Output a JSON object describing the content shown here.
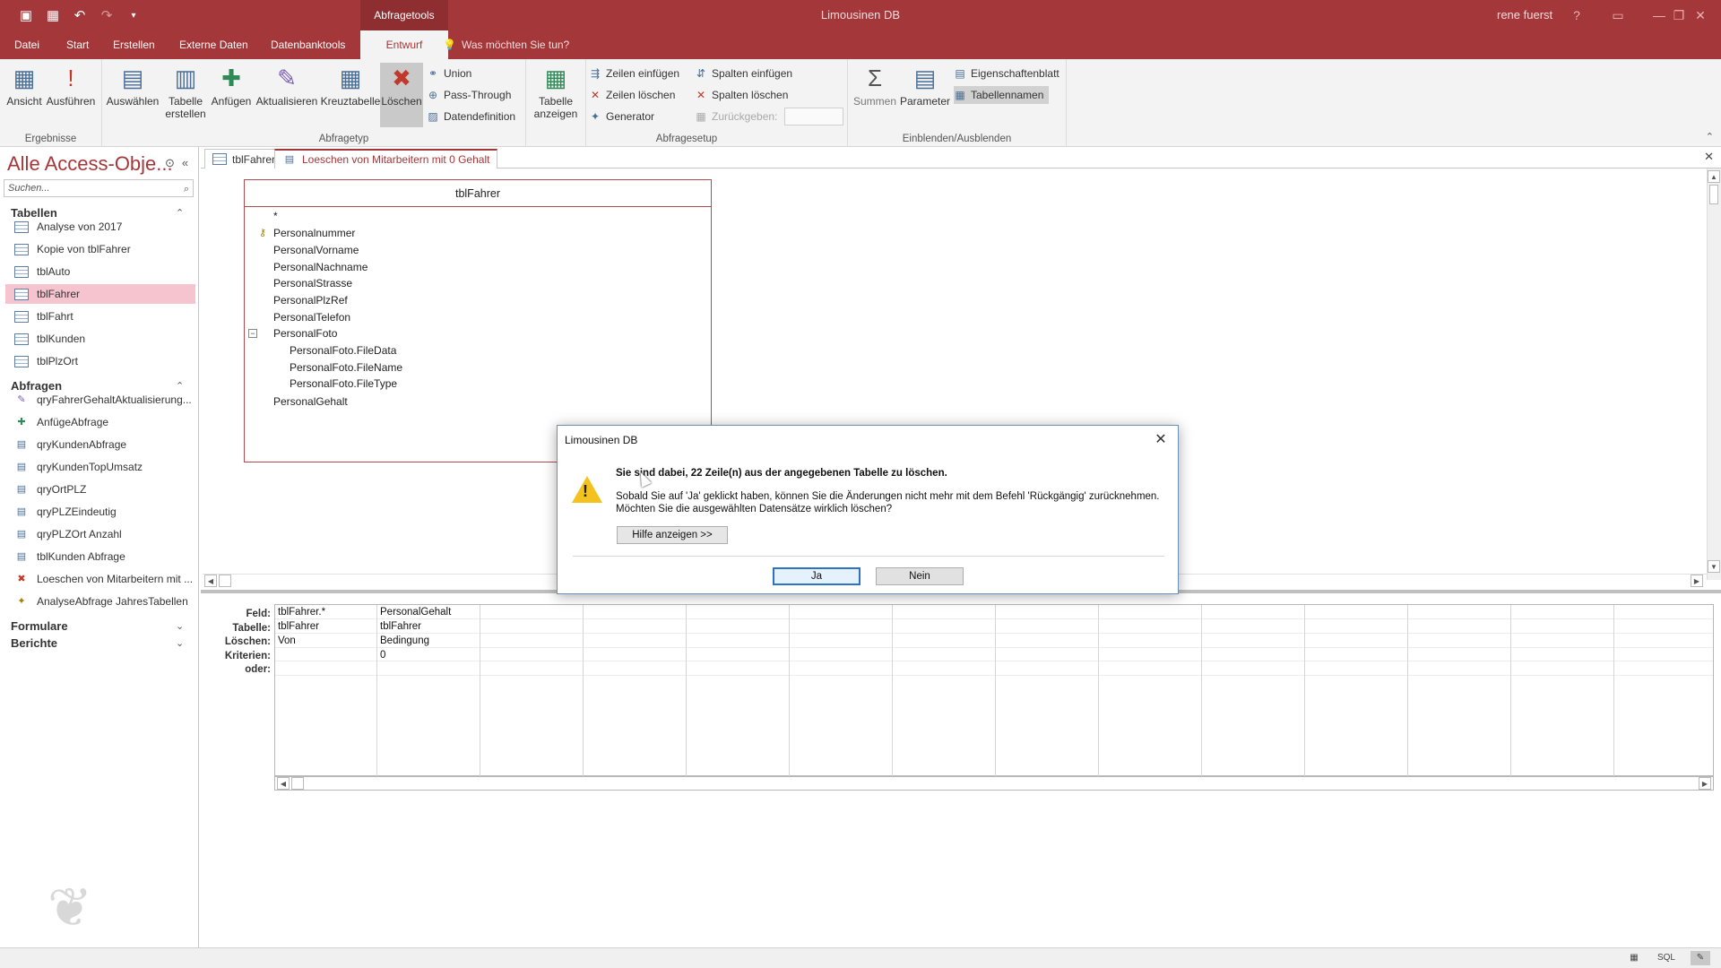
{
  "window": {
    "app_title": "Limousinen DB",
    "context_tab_label": "Abfragetools",
    "user_name": "rene fuerst"
  },
  "ribbon_tabs": [
    "Datei",
    "Start",
    "Erstellen",
    "Externe Daten",
    "Datenbanktools",
    "Entwurf"
  ],
  "active_tab": "Entwurf",
  "tell_me": "Was möchten Sie tun?",
  "ribbon": {
    "groups": {
      "ergebnisse": "Ergebnisse",
      "abfragetyp": "Abfragetyp",
      "abfragesetup": "Abfragesetup",
      "einblenden": "Einblenden/Ausblenden"
    },
    "ansicht": "Ansicht",
    "ausfuehren": "Ausführen",
    "auswaehlen": "Auswählen",
    "tabelle_erstellen_1": "Tabelle",
    "tabelle_erstellen_2": "erstellen",
    "anfuegen": "Anfügen",
    "aktualisieren": "Aktualisieren",
    "kreuztabelle": "Kreuztabelle",
    "loeschen": "Löschen",
    "union": "Union",
    "pass_through": "Pass-Through",
    "datendefinition": "Datendefinition",
    "tabelle_anzeigen_1": "Tabelle",
    "tabelle_anzeigen_2": "anzeigen",
    "zeilen_einfuegen": "Zeilen einfügen",
    "zeilen_loeschen": "Zeilen löschen",
    "generator": "Generator",
    "spalten_einfuegen": "Spalten einfügen",
    "spalten_loeschen": "Spalten löschen",
    "zurueckgeben": "Zurückgeben:",
    "summen": "Summen",
    "parameter": "Parameter",
    "eigenschaftenblatt": "Eigenschaftenblatt",
    "tabellennamen": "Tabellennamen"
  },
  "nav": {
    "header": "Alle Access-Obje...",
    "search_placeholder": "Suchen...",
    "sections": {
      "tabellen": "Tabellen",
      "abfragen": "Abfragen",
      "formulare": "Formulare",
      "berichte": "Berichte"
    },
    "tables": [
      "Analyse von 2017",
      "Kopie von tblFahrer",
      "tblAuto",
      "tblFahrer",
      "tblFahrt",
      "tblKunden",
      "tblPlzOrt"
    ],
    "selected_table": "tblFahrer",
    "queries": [
      "qryFahrerGehaltAktualisierung...",
      "AnfügeAbfrage",
      "qryKundenAbfrage",
      "qryKundenTopUmsatz",
      "qryOrtPLZ",
      "qryPLZEindeutig",
      "qryPLZOrt Anzahl",
      "tblKunden Abfrage",
      "Loeschen von Mitarbeitern mit ...",
      "AnalyseAbfrage JahresTabellen"
    ]
  },
  "doc_tabs": [
    "tblFahrer",
    "Loeschen von Mitarbeitern mit 0 Gehalt"
  ],
  "table_box": {
    "title": "tblFahrer",
    "fields": [
      "*",
      "Personalnummer",
      "PersonalVorname",
      "PersonalNachname",
      "PersonalStrasse",
      "PersonalPlzRef",
      "PersonalTelefon",
      "PersonalFoto",
      "PersonalFoto.FileData",
      "PersonalFoto.FileName",
      "PersonalFoto.FileType",
      "PersonalGehalt"
    ]
  },
  "qbe": {
    "row_labels": [
      "Feld:",
      "Tabelle:",
      "Löschen:",
      "Kriterien:",
      "oder:"
    ],
    "columns": [
      {
        "feld": "tblFahrer.*",
        "tabelle": "tblFahrer",
        "loeschen": "Von",
        "kriterien": ""
      },
      {
        "feld": "PersonalGehalt",
        "tabelle": "tblFahrer",
        "loeschen": "Bedingung",
        "kriterien": "0"
      }
    ]
  },
  "dialog": {
    "title": "Limousinen DB",
    "message_bold": "Sie sind dabei, 22 Zeile(n) aus der angegebenen Tabelle zu löschen.",
    "message_line1": "Sobald Sie auf 'Ja' geklickt haben, können Sie die Änderungen nicht mehr mit dem Befehl 'Rückgängig' zurücknehmen.",
    "message_line2": "Möchten Sie die ausgewählten Datensätze wirklich löschen?",
    "help_button": "Hilfe anzeigen >>",
    "yes_button": "Ja",
    "no_button": "Nein"
  },
  "statusbar": {
    "sql_label": "SQL"
  },
  "colors": {
    "accent": "#a4373a",
    "selected_nav": "#f6c4ce",
    "warning": "#f3c21f"
  }
}
